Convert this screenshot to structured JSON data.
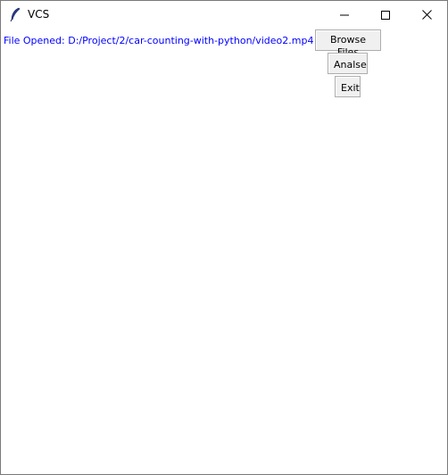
{
  "window": {
    "title": "VCS",
    "icon": "feather-icon"
  },
  "controls": {
    "minimize": "minimize-icon",
    "maximize": "maximize-icon",
    "close": "close-icon"
  },
  "main": {
    "file_label": "File Opened: D:/Project/2/car-counting-with-python/video2.mp4",
    "file_label_color": "#0000ff",
    "buttons": {
      "browse": "Browse Files",
      "analyse": "Analse",
      "exit": "Exit"
    }
  }
}
